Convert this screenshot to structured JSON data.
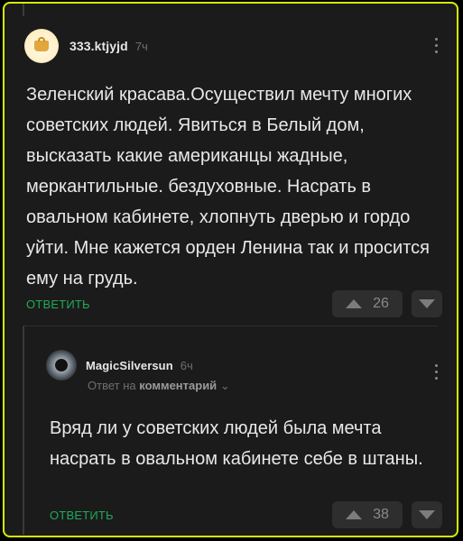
{
  "comments": [
    {
      "username": "333.ktjyjd",
      "time": "7ч",
      "text": "Зеленский красава.Осуществил мечту многих советских людей. Явиться в Белый дом, высказать какие американцы жадные, меркантильные. бездуховные. Насрать в овальном кабинете, хлопнуть дверью и гордо уйти. Мне кажется орден Ленина так и просится ему на грудь.",
      "reply_label": "ОТВЕТИТЬ",
      "votes": "26"
    },
    {
      "username": "MagicSilversun",
      "time": "6ч",
      "reply_prefix": "Ответ на",
      "reply_target": "комментарий",
      "reply_chevron": "⌄",
      "text": "Вряд ли у советских людей была мечта насрать в овальном кабинете себе в штаны.",
      "reply_label": "ОТВЕТИТЬ",
      "votes": "38"
    }
  ],
  "colors": {
    "accent": "#1faa5a",
    "border": "#d8f000",
    "background": "#1b1b1b"
  },
  "icons": [
    "avatar-bag-icon",
    "avatar-disc-icon",
    "more-dots-icon",
    "upvote-icon",
    "downvote-icon"
  ]
}
